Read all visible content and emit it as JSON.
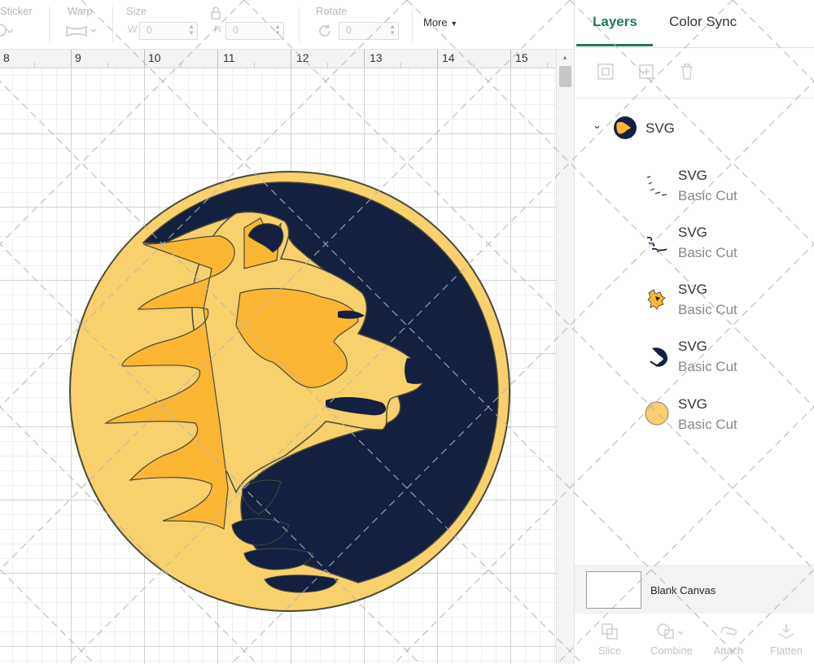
{
  "toolbar": {
    "sticker_label": "Sticker",
    "warp_label": "Warp",
    "size_label": "Size",
    "size_w_label": "W",
    "size_w_value": "0",
    "size_h_label": "H",
    "size_h_value": "0",
    "rotate_label": "Rotate",
    "rotate_value": "0",
    "more_label": "More"
  },
  "ruler": {
    "numbers": [
      "8",
      "9",
      "10",
      "11",
      "12",
      "13",
      "14",
      "15"
    ]
  },
  "panel": {
    "tabs": [
      {
        "label": "Layers",
        "active": true
      },
      {
        "label": "Color Sync",
        "active": false
      }
    ],
    "group": {
      "name": "SVG",
      "icon": "lion-logo-thumbnail"
    },
    "layers": [
      {
        "name": "SVG",
        "type": "Basic Cut",
        "thumb": "dark-outline-strokes-thumbnail"
      },
      {
        "name": "SVG",
        "type": "Basic Cut",
        "thumb": "dark-claw-strokes-thumbnail"
      },
      {
        "name": "SVG",
        "type": "Basic Cut",
        "thumb": "yellow-mane-thumbnail"
      },
      {
        "name": "SVG",
        "type": "Basic Cut",
        "thumb": "navy-crescent-thumbnail"
      },
      {
        "name": "SVG",
        "type": "Basic Cut",
        "thumb": "yellow-circle-thumbnail"
      }
    ],
    "blank_canvas_label": "Blank Canvas",
    "bottom_actions": [
      {
        "label": "Slice",
        "icon": "slice-icon"
      },
      {
        "label": "Combine",
        "icon": "combine-icon"
      },
      {
        "label": "Attach",
        "icon": "attach-icon"
      },
      {
        "label": "Flatten",
        "icon": "flatten-icon"
      }
    ]
  },
  "colors": {
    "accent": "#1f7a5c",
    "logo_yellow": "#f8d06c",
    "logo_orange": "#fbb634",
    "logo_navy": "#13203f",
    "logo_outline": "#4a4a3a"
  }
}
